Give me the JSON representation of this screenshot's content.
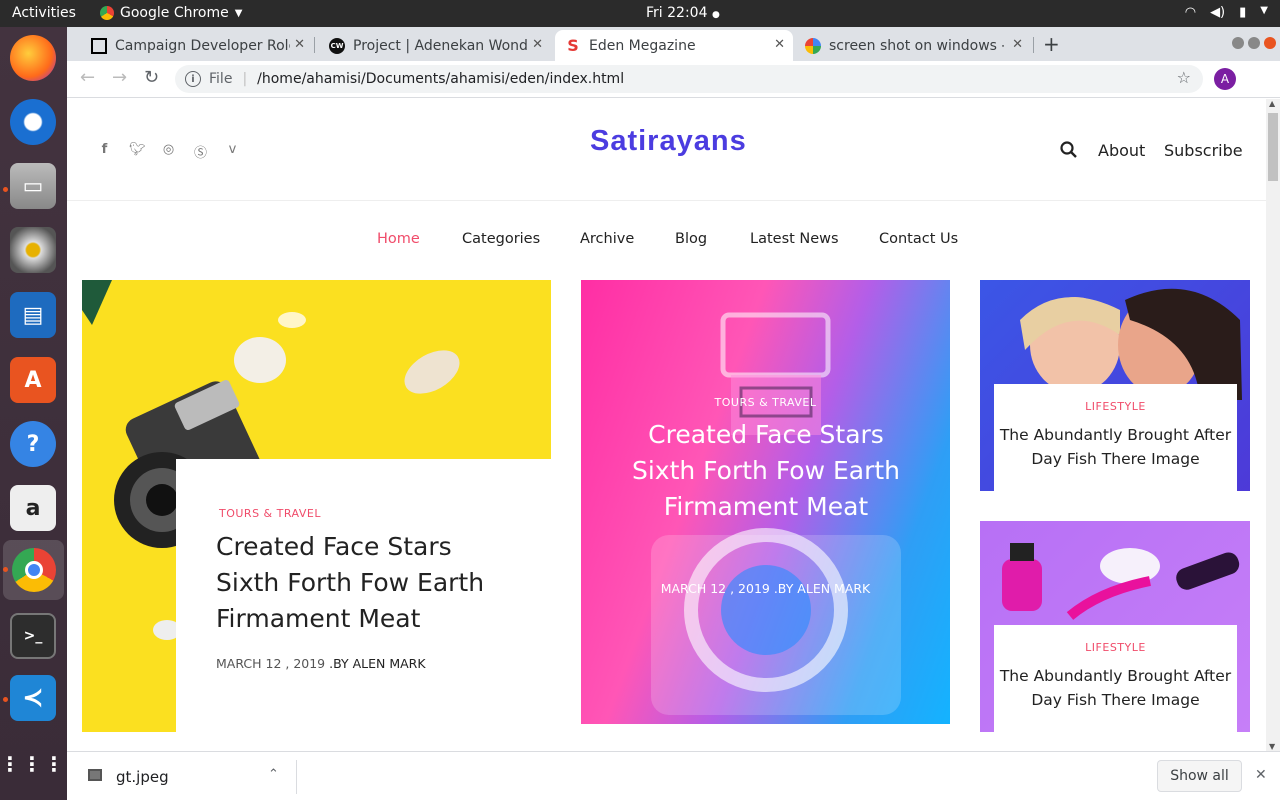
{
  "topbar": {
    "activities": "Activities",
    "app": "Google Chrome",
    "clock": "Fri 22:04"
  },
  "dock": [
    "firefox-icon",
    "thunderbird-icon",
    "files-icon",
    "rhythmbox-icon",
    "writer-icon",
    "software-icon",
    "help-icon",
    "amazon-icon",
    "chrome-icon",
    "terminal-icon",
    "vscode-icon",
    "apps-grid-icon"
  ],
  "tabs": [
    {
      "label": "Campaign Developer Role"
    },
    {
      "label": "Project | Adenekan Wonder"
    },
    {
      "label": "Eden Megazine"
    },
    {
      "label": "screen shot on windows - "
    }
  ],
  "toolbar": {
    "file_label": "File",
    "url": "/home/ahamisi/Documents/ahamisi/eden/index.html",
    "avatar": "A"
  },
  "site": {
    "logo": "Satirayans",
    "about": "About",
    "subscribe": "Subscribe",
    "nav": [
      "Home",
      "Categories",
      "Archive",
      "Blog",
      "Latest News",
      "Contact Us"
    ]
  },
  "posts": {
    "main": {
      "category": "TOURS & TRAVEL",
      "title": "Created Face Stars Sixth Forth Fow Earth Firmament Meat",
      "date": "MARCH 12 , 2019 ",
      "by": ".BY ALEN MARK"
    },
    "center": {
      "category": "TOURS & TRAVEL",
      "title": "Created Face Stars Sixth Forth Fow Earth Firmament Meat",
      "meta": "MARCH 12 , 2019 .BY ALEN MARK"
    },
    "side1": {
      "category": "LIFESTYLE",
      "title": "The Abundantly Brought After Day Fish There Image"
    },
    "side2": {
      "category": "LIFESTYLE",
      "title": "The Abundantly Brought After Day Fish There Image"
    }
  },
  "download": {
    "file": "gt.jpeg",
    "show_all": "Show all"
  }
}
